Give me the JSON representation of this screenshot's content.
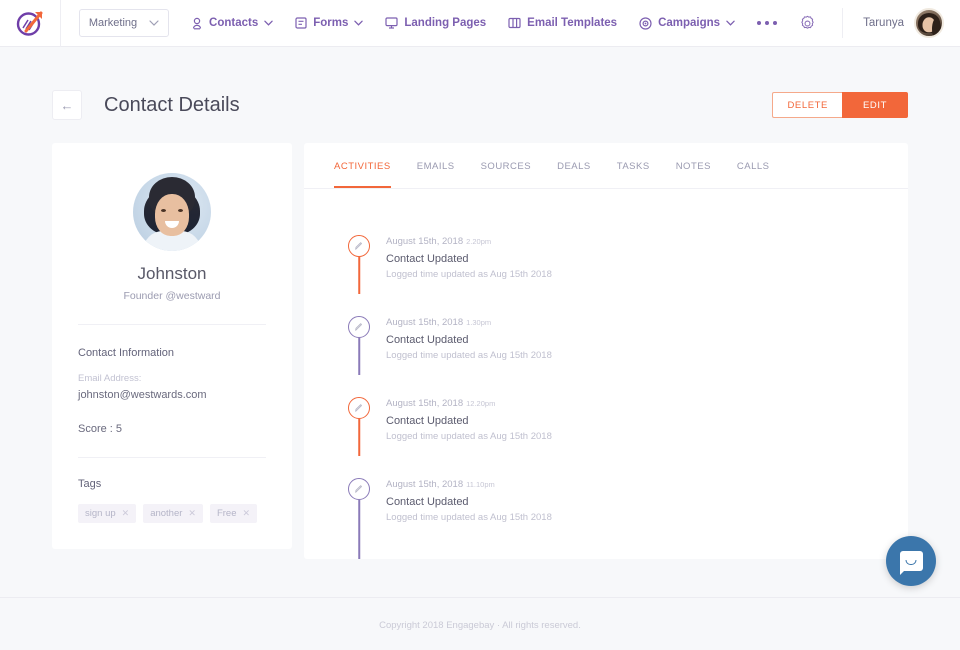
{
  "topnav": {
    "logo_icon": "engagebay-logo-icon",
    "workspace": {
      "value": "Marketing",
      "caret_icon": "chevron-down-icon"
    },
    "items": [
      {
        "label": "Contacts",
        "icon": "contact-person-icon",
        "has_caret": true
      },
      {
        "label": "Forms",
        "icon": "form-document-icon",
        "has_caret": true
      },
      {
        "label": "Landing Pages",
        "icon": "monitor-screen-icon",
        "has_caret": false
      },
      {
        "label": "Email Templates",
        "icon": "template-columns-icon",
        "has_caret": false
      },
      {
        "label": "Campaigns",
        "icon": "campaign-target-icon",
        "has_caret": true
      }
    ],
    "more_icon": "ellipsis-more-icon",
    "settings_icon": "gear-icon",
    "user": {
      "name": "Tarunya",
      "avatar_icon": "user-avatar"
    },
    "accent_color": "#7c5fb0"
  },
  "page": {
    "back_icon": "arrow-left-icon",
    "title": "Contact Details",
    "delete_label": "DELETE",
    "edit_label": "EDIT",
    "primary_color": "#f2673a"
  },
  "contact": {
    "avatar_icon": "contact-photo",
    "name": "Johnston",
    "role": "Founder @westward",
    "section_title": "Contact Information",
    "email_label": "Email Address:",
    "email_value": "johnston@westwards.com",
    "score": "Score : 5",
    "tags_title": "Tags",
    "tags": [
      {
        "label": "sign up",
        "remove_icon": "close-icon"
      },
      {
        "label": "another",
        "remove_icon": "close-icon"
      },
      {
        "label": "Free",
        "remove_icon": "close-icon"
      }
    ]
  },
  "tabs": [
    {
      "label": "ACTIVITIES",
      "active": true
    },
    {
      "label": "EMAILS",
      "active": false
    },
    {
      "label": "SOURCES",
      "active": false
    },
    {
      "label": "DEALS",
      "active": false
    },
    {
      "label": "TASKS",
      "active": false
    },
    {
      "label": "NOTES",
      "active": false
    },
    {
      "label": "CALLS",
      "active": false
    }
  ],
  "timeline": [
    {
      "date": "August 15th, 2018",
      "time": "2.20pm",
      "title": "Contact Updated",
      "subtitle": "Logged time updated as Aug 15th 2018",
      "icon": "pencil-edit-icon",
      "color": "#f2673a"
    },
    {
      "date": "August 15th, 2018",
      "time": "1.30pm",
      "title": "Contact Updated",
      "subtitle": "Logged time updated as Aug 15th 2018",
      "icon": "pencil-edit-icon",
      "color": "#8a7ab8"
    },
    {
      "date": "August 15th, 2018",
      "time": "12.20pm",
      "title": "Contact Updated",
      "subtitle": "Logged time updated as Aug 15th 2018",
      "icon": "pencil-edit-icon",
      "color": "#f2673a"
    },
    {
      "date": "August 15th, 2018",
      "time": "11.10pm",
      "title": "Contact Updated",
      "subtitle": "Logged time updated as Aug 15th 2018",
      "icon": "pencil-edit-icon",
      "color": "#8a7ab8"
    }
  ],
  "footer": {
    "copyright": "Copyright 2018 Engagebay · All rights reserved."
  },
  "intercom": {
    "icon": "chat-bubble-icon",
    "color": "#3b76ab"
  }
}
